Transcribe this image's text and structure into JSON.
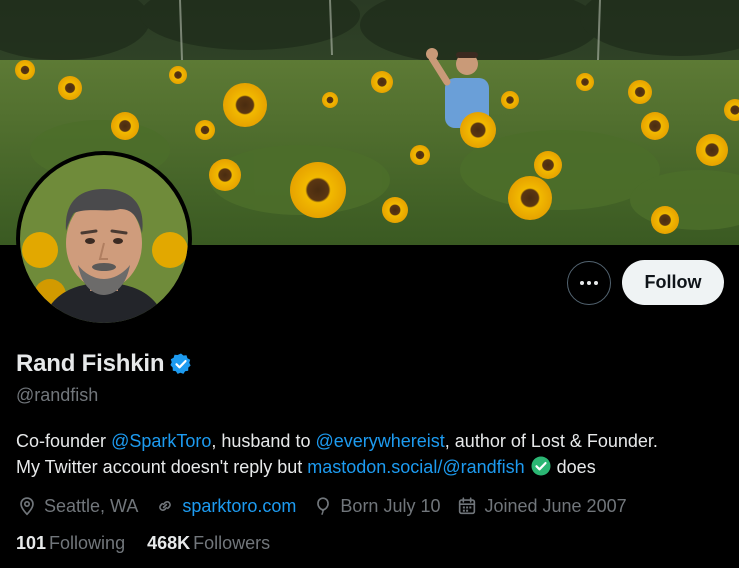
{
  "profile": {
    "display_name": "Rand Fishkin",
    "handle": "@randfish",
    "follow_label": "Follow",
    "bio": {
      "t1": "Co-founder ",
      "link1": "@SparkToro",
      "t2": ", husband to ",
      "link2": "@everywhereist",
      "t3": ", author of Lost & Founder.",
      "t4": "My Twitter account doesn't reply but ",
      "link3": "mastodon.social/@randfish",
      "t5": " does"
    },
    "location": "Seattle, WA",
    "website": "sparktoro.com",
    "birthday": "Born July 10",
    "joined": "Joined June 2007",
    "following_count": "101",
    "following_label": "Following",
    "followers_count": "468K",
    "followers_label": "Followers"
  },
  "icons": {
    "more": "more-horizontal-icon",
    "verified": "verified-badge-icon",
    "location": "location-pin-icon",
    "link": "link-icon",
    "birthday": "balloon-icon",
    "joined": "calendar-icon",
    "check_emoji": "check-mark-emoji"
  },
  "colors": {
    "background": "#000000",
    "text_primary": "#e7e9ea",
    "text_secondary": "#71767b",
    "accent": "#1d9bf0",
    "follow_button_bg": "#eff3f4",
    "emoji_green": "#2bb673"
  }
}
